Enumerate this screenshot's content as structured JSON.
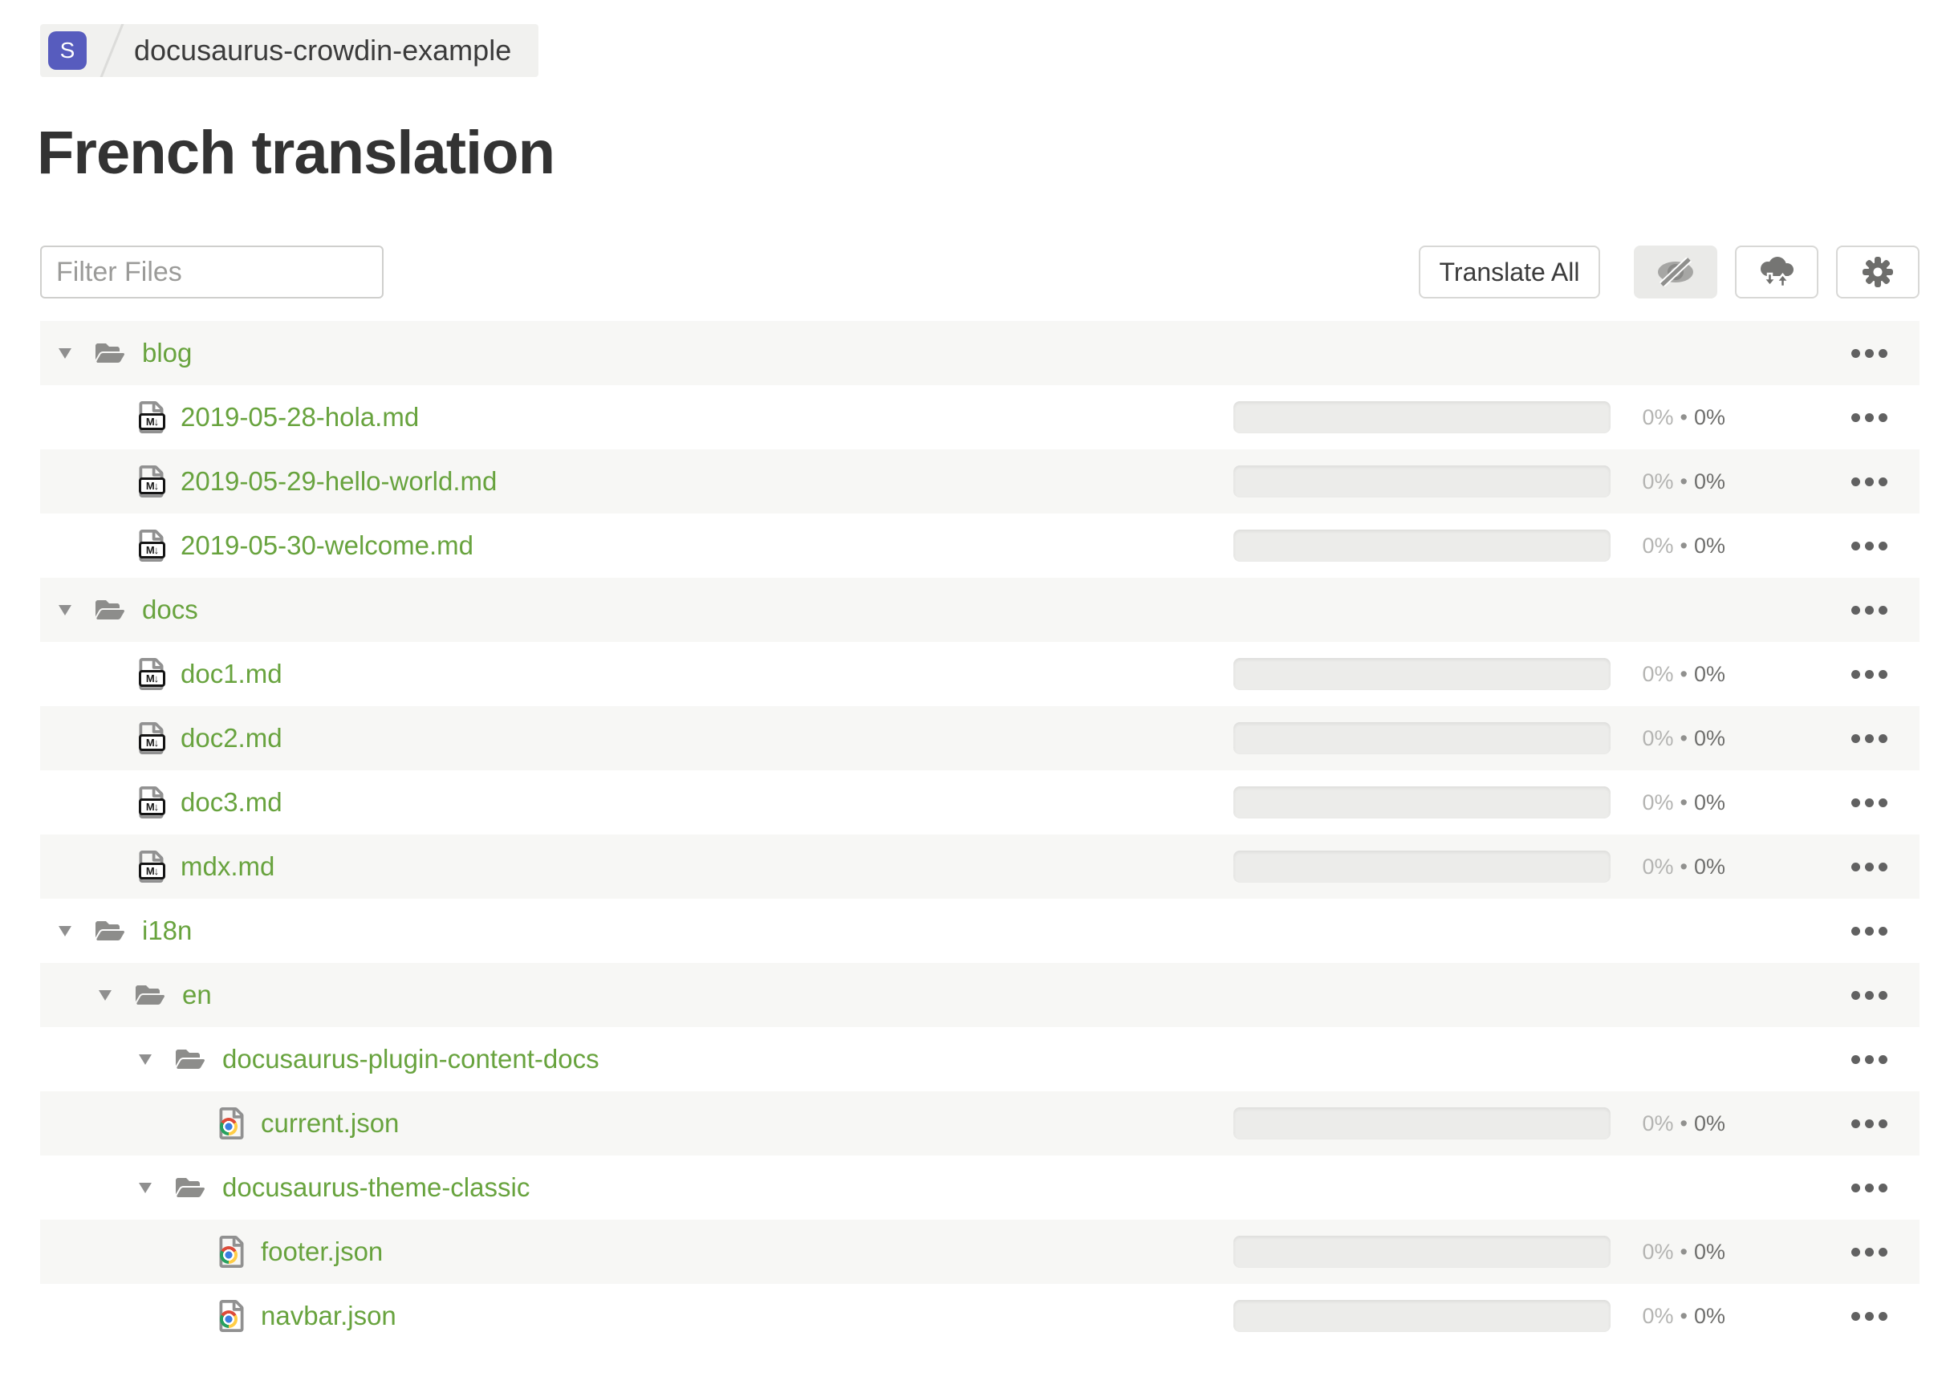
{
  "breadcrumb": {
    "badge": "S",
    "project": "docusaurus-crowdin-example"
  },
  "page": {
    "title": "French translation"
  },
  "toolbar": {
    "filter_placeholder": "Filter Files",
    "translate_all_label": "Translate All",
    "icon_buttons": [
      "eye-slash-icon",
      "cloud-sync-icon",
      "settings-gear-icon"
    ]
  },
  "icons": {
    "md_glyph": "M↓"
  },
  "tree": {
    "rows": [
      {
        "kind": "folder",
        "level": 0,
        "name": "blog"
      },
      {
        "kind": "file",
        "filetype": "md",
        "level": 1,
        "name": "2019-05-28-hola.md",
        "translated": "0%",
        "bullet": "•",
        "approved": "0%"
      },
      {
        "kind": "file",
        "filetype": "md",
        "level": 1,
        "name": "2019-05-29-hello-world.md",
        "translated": "0%",
        "bullet": "•",
        "approved": "0%"
      },
      {
        "kind": "file",
        "filetype": "md",
        "level": 1,
        "name": "2019-05-30-welcome.md",
        "translated": "0%",
        "bullet": "•",
        "approved": "0%"
      },
      {
        "kind": "folder",
        "level": 0,
        "name": "docs"
      },
      {
        "kind": "file",
        "filetype": "md",
        "level": 1,
        "name": "doc1.md",
        "translated": "0%",
        "bullet": "•",
        "approved": "0%"
      },
      {
        "kind": "file",
        "filetype": "md",
        "level": 1,
        "name": "doc2.md",
        "translated": "0%",
        "bullet": "•",
        "approved": "0%"
      },
      {
        "kind": "file",
        "filetype": "md",
        "level": 1,
        "name": "doc3.md",
        "translated": "0%",
        "bullet": "•",
        "approved": "0%"
      },
      {
        "kind": "file",
        "filetype": "md",
        "level": 1,
        "name": "mdx.md",
        "translated": "0%",
        "bullet": "•",
        "approved": "0%"
      },
      {
        "kind": "folder",
        "level": 0,
        "name": "i18n"
      },
      {
        "kind": "folder",
        "level": 1,
        "name": "en"
      },
      {
        "kind": "folder",
        "level": 2,
        "name": "docusaurus-plugin-content-docs"
      },
      {
        "kind": "file",
        "filetype": "json",
        "level": 3,
        "name": "current.json",
        "translated": "0%",
        "bullet": "•",
        "approved": "0%"
      },
      {
        "kind": "folder",
        "level": 2,
        "name": "docusaurus-theme-classic"
      },
      {
        "kind": "file",
        "filetype": "json",
        "level": 3,
        "name": "footer.json",
        "translated": "0%",
        "bullet": "•",
        "approved": "0%"
      },
      {
        "kind": "file",
        "filetype": "json",
        "level": 3,
        "name": "navbar.json",
        "translated": "0%",
        "bullet": "•",
        "approved": "0%"
      }
    ]
  }
}
